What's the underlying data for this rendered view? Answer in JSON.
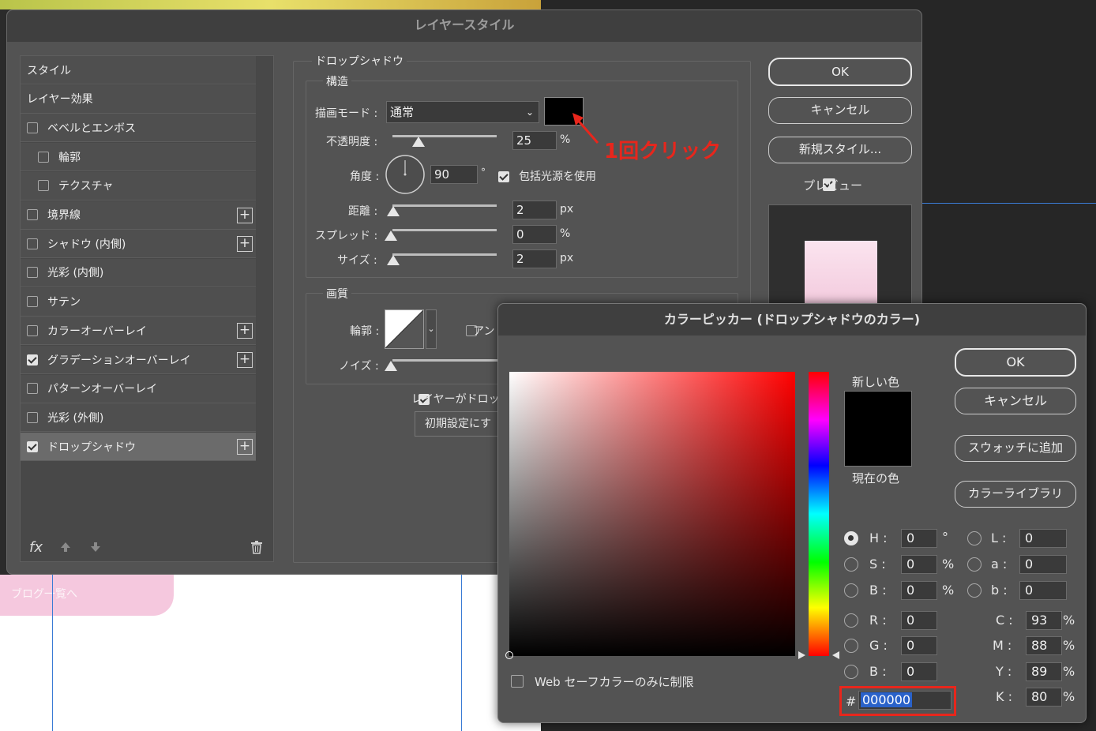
{
  "background": {
    "blog_link": "ブログ一覧へ"
  },
  "layer_style": {
    "title": "レイヤースタイル",
    "list": [
      {
        "label": "スタイル",
        "type": "header"
      },
      {
        "label": "レイヤー効果",
        "type": "header"
      },
      {
        "label": "ベベルとエンボス",
        "checked": false,
        "indent": false,
        "plus": false
      },
      {
        "label": "輪郭",
        "checked": false,
        "indent": true,
        "plus": false
      },
      {
        "label": "テクスチャ",
        "checked": false,
        "indent": true,
        "plus": false
      },
      {
        "label": "境界線",
        "checked": false,
        "indent": false,
        "plus": true
      },
      {
        "label": "シャドウ (内側)",
        "checked": false,
        "indent": false,
        "plus": true
      },
      {
        "label": "光彩 (内側)",
        "checked": false,
        "indent": false,
        "plus": false
      },
      {
        "label": "サテン",
        "checked": false,
        "indent": false,
        "plus": false
      },
      {
        "label": "カラーオーバーレイ",
        "checked": false,
        "indent": false,
        "plus": true
      },
      {
        "label": "グラデーションオーバーレイ",
        "checked": true,
        "indent": false,
        "plus": true
      },
      {
        "label": "パターンオーバーレイ",
        "checked": false,
        "indent": false,
        "plus": false
      },
      {
        "label": "光彩 (外側)",
        "checked": false,
        "indent": false,
        "plus": false
      },
      {
        "label": "ドロップシャドウ",
        "checked": true,
        "indent": false,
        "plus": true,
        "selected": true
      }
    ],
    "footer": {
      "fx": "fx"
    },
    "section_title": "ドロップシャドウ",
    "structure": {
      "legend": "構造",
      "blend_mode_label": "描画モード :",
      "blend_mode": "通常",
      "opacity_label": "不透明度 :",
      "opacity": "25",
      "opacity_unit": "%",
      "angle_label": "角度 :",
      "angle": "90",
      "angle_unit": "°",
      "global_light_label": "包括光源を使用",
      "distance_label": "距離 :",
      "distance": "2",
      "distance_unit": "px",
      "spread_label": "スプレッド :",
      "spread": "0",
      "spread_unit": "%",
      "size_label": "サイズ :",
      "size": "2",
      "size_unit": "px"
    },
    "quality": {
      "legend": "画質",
      "contour_label": "輪郭 :",
      "antialias_label": "アン",
      "noise_label": "ノイズ :"
    },
    "knockout_label": "レイヤーがドロッ",
    "reset_button": "初期設定にす",
    "annotation": "1回クリック",
    "annotation_color": "#e8261c",
    "buttons": {
      "ok": "OK",
      "cancel": "キャンセル",
      "new_style": "新規スタイル...",
      "preview": "プレビュー"
    },
    "shadow_color": "#000000"
  },
  "color_picker": {
    "title": "カラーピッカー (ドロップシャドウのカラー)",
    "new_color_label": "新しい色",
    "current_color_label": "現在の色",
    "buttons": {
      "ok": "OK",
      "cancel": "キャンセル",
      "add_swatch": "スウォッチに追加",
      "library": "カラーライブラリ"
    },
    "web_safe_label": "Web セーフカラーのみに制限",
    "hsb": {
      "h": "0",
      "s": "0",
      "b": "0",
      "h_unit": "°",
      "s_unit": "%",
      "b_unit": "%"
    },
    "lab": {
      "l": "0",
      "a": "0",
      "b": "0"
    },
    "rgb": {
      "r": "0",
      "g": "0",
      "b": "0"
    },
    "cmyk": {
      "c": "93",
      "m": "88",
      "y": "89",
      "k": "80",
      "unit": "%"
    },
    "labels": {
      "h": "H :",
      "s": "S :",
      "b": "B :",
      "l": "L :",
      "a": "a :",
      "lb": "b :",
      "r": "R :",
      "g": "G :",
      "rb": "B :",
      "c": "C :",
      "m": "M :",
      "y": "Y :",
      "k": "K :"
    },
    "hex_prefix": "#",
    "hex": "000000",
    "highlight_color": "#e8261c"
  }
}
